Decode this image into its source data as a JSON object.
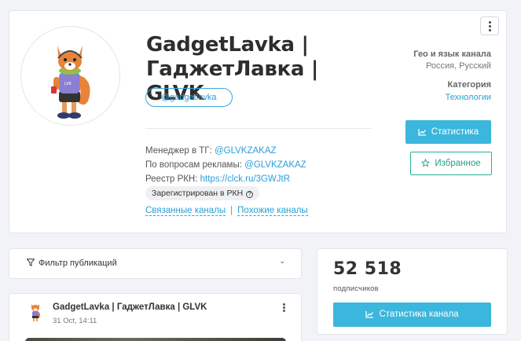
{
  "profile": {
    "title": "GadgetLavka | ГаджетЛавка | GLVK",
    "username": "@gadgetlavka",
    "manager_label": "Менеджер в ТГ:",
    "manager_value": "@GLVKZAKAZ",
    "ads_label": "По вопросам рекламы:",
    "ads_value": "@GLVKZAKAZ",
    "registry_label": "Реестр РКН:",
    "registry_value": "https://clck.ru/3GWJtR",
    "rkn_badge": "Зарегистрирован в РКН",
    "related_link": "Связанные каналы",
    "separator": "|",
    "similar_link": "Похожие каналы",
    "geo_label": "Гео и язык канала",
    "geo_value": "Россия, Русский",
    "category_label": "Категория",
    "category_value": "Технологии",
    "stats_button": "Статистика",
    "favorite_button": "Избранное"
  },
  "filter": {
    "label": "Фильтр публикаций"
  },
  "subscribers": {
    "count": "52 518",
    "label": "подписчиков",
    "button": "Статистика канала"
  },
  "post": {
    "title": "GadgetLavka | ГаджетЛавка | GLVK",
    "date": "31 Oct, 14:11"
  },
  "colors": {
    "accent": "#3bb6dd",
    "link": "#2a9fd6",
    "favorite": "#21a08b"
  },
  "icons": {
    "menu": "vertical-dots-icon",
    "stats": "chart-icon",
    "favorite": "star-icon",
    "filter": "funnel-icon",
    "dropdown": "chevron-down-icon",
    "help": "question-circle-icon"
  }
}
